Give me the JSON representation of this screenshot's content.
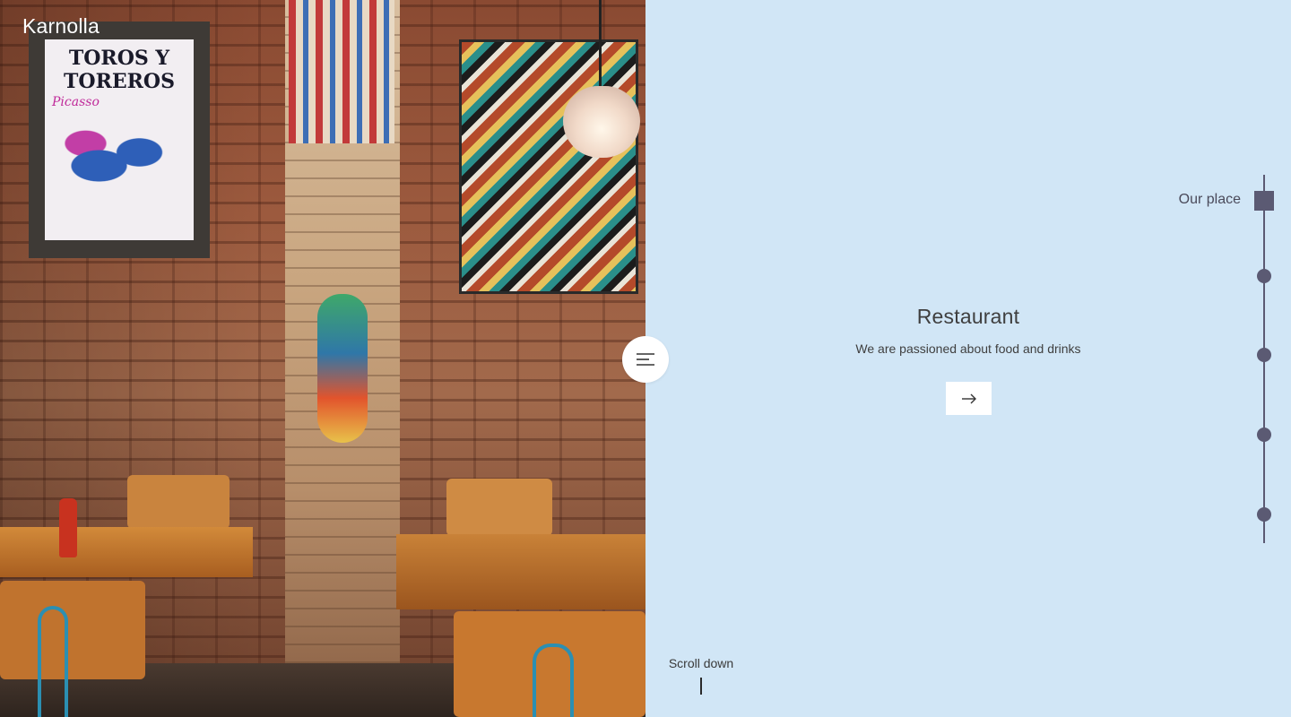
{
  "brand": {
    "name": "Karnolla"
  },
  "hero": {
    "title": "Restaurant",
    "subtitle": "We are passioned about food and drinks"
  },
  "timeline": {
    "active_label": "Our place",
    "item_count": 5
  },
  "scroll": {
    "label": "Scroll down"
  },
  "icons": {
    "menu": "hamburger-menu-icon",
    "next": "arrow-right-icon"
  },
  "colors": {
    "panel_background": "#d1e6f6",
    "timeline": "#5b5a73",
    "button_background": "#ffffff"
  }
}
